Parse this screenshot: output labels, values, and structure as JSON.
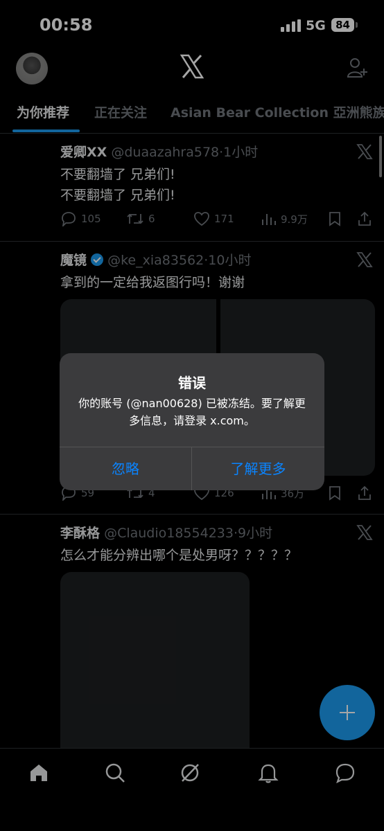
{
  "status_bar": {
    "time": "00:58",
    "network": "5G",
    "battery": "84"
  },
  "header": {
    "logo_icon": "x-logo-icon",
    "add_icon": "add-user-icon"
  },
  "tabs": [
    {
      "label": "为你推荐",
      "active": true
    },
    {
      "label": "正在关注",
      "active": false
    },
    {
      "label": "Asian Bear Collection 亞洲熊族",
      "active": false
    }
  ],
  "tweets": [
    {
      "name": "爱卿ⅩⅩ",
      "handle": "@duaazahra578",
      "time": "·1小时",
      "verified": false,
      "lines": [
        "不要翻墙了 兄弟们!",
        "不要翻墙了 兄弟们!"
      ],
      "replies": "105",
      "retweets": "6",
      "likes": "171",
      "views": "9.9万"
    },
    {
      "name": "魔镜",
      "handle": "@ke_xia83562",
      "time": "·10小时",
      "verified": true,
      "lines": [
        "拿到的一定给我返图行吗！谢谢"
      ],
      "replies": "59",
      "retweets": "4",
      "likes": "126",
      "views": "36万"
    },
    {
      "name": "李酥格",
      "handle": "@Claudio18554233",
      "time": "·9小时",
      "verified": false,
      "lines": [
        "怎么才能分辨出哪个是处男呀？？？？？"
      ]
    }
  ],
  "dialog": {
    "title": "错误",
    "message": "你的账号 (@nan00628) 已被冻结。要了解更多信息，请登录 x.com。",
    "ignore_label": "忽略",
    "learn_more_label": "了解更多"
  },
  "bottom_nav": [
    "home-icon",
    "search-icon",
    "grok-icon",
    "notifications-icon",
    "messages-icon"
  ],
  "colors": {
    "accent": "#1d9bf0",
    "dialog_button": "#0a84ff",
    "background": "#000000"
  }
}
